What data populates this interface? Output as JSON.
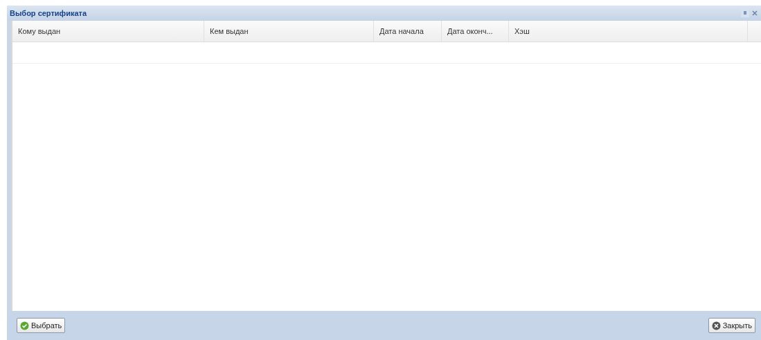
{
  "window": {
    "title": "Выбор сертификата"
  },
  "table": {
    "columns": [
      "Кому выдан",
      "Кем выдан",
      "Дата начала",
      "Дата оконч...",
      "Хэш"
    ]
  },
  "buttons": [
    {
      "kind": "select",
      "label": "Выбрать"
    },
    {
      "kind": "close",
      "label": "Закрыть"
    }
  ]
}
